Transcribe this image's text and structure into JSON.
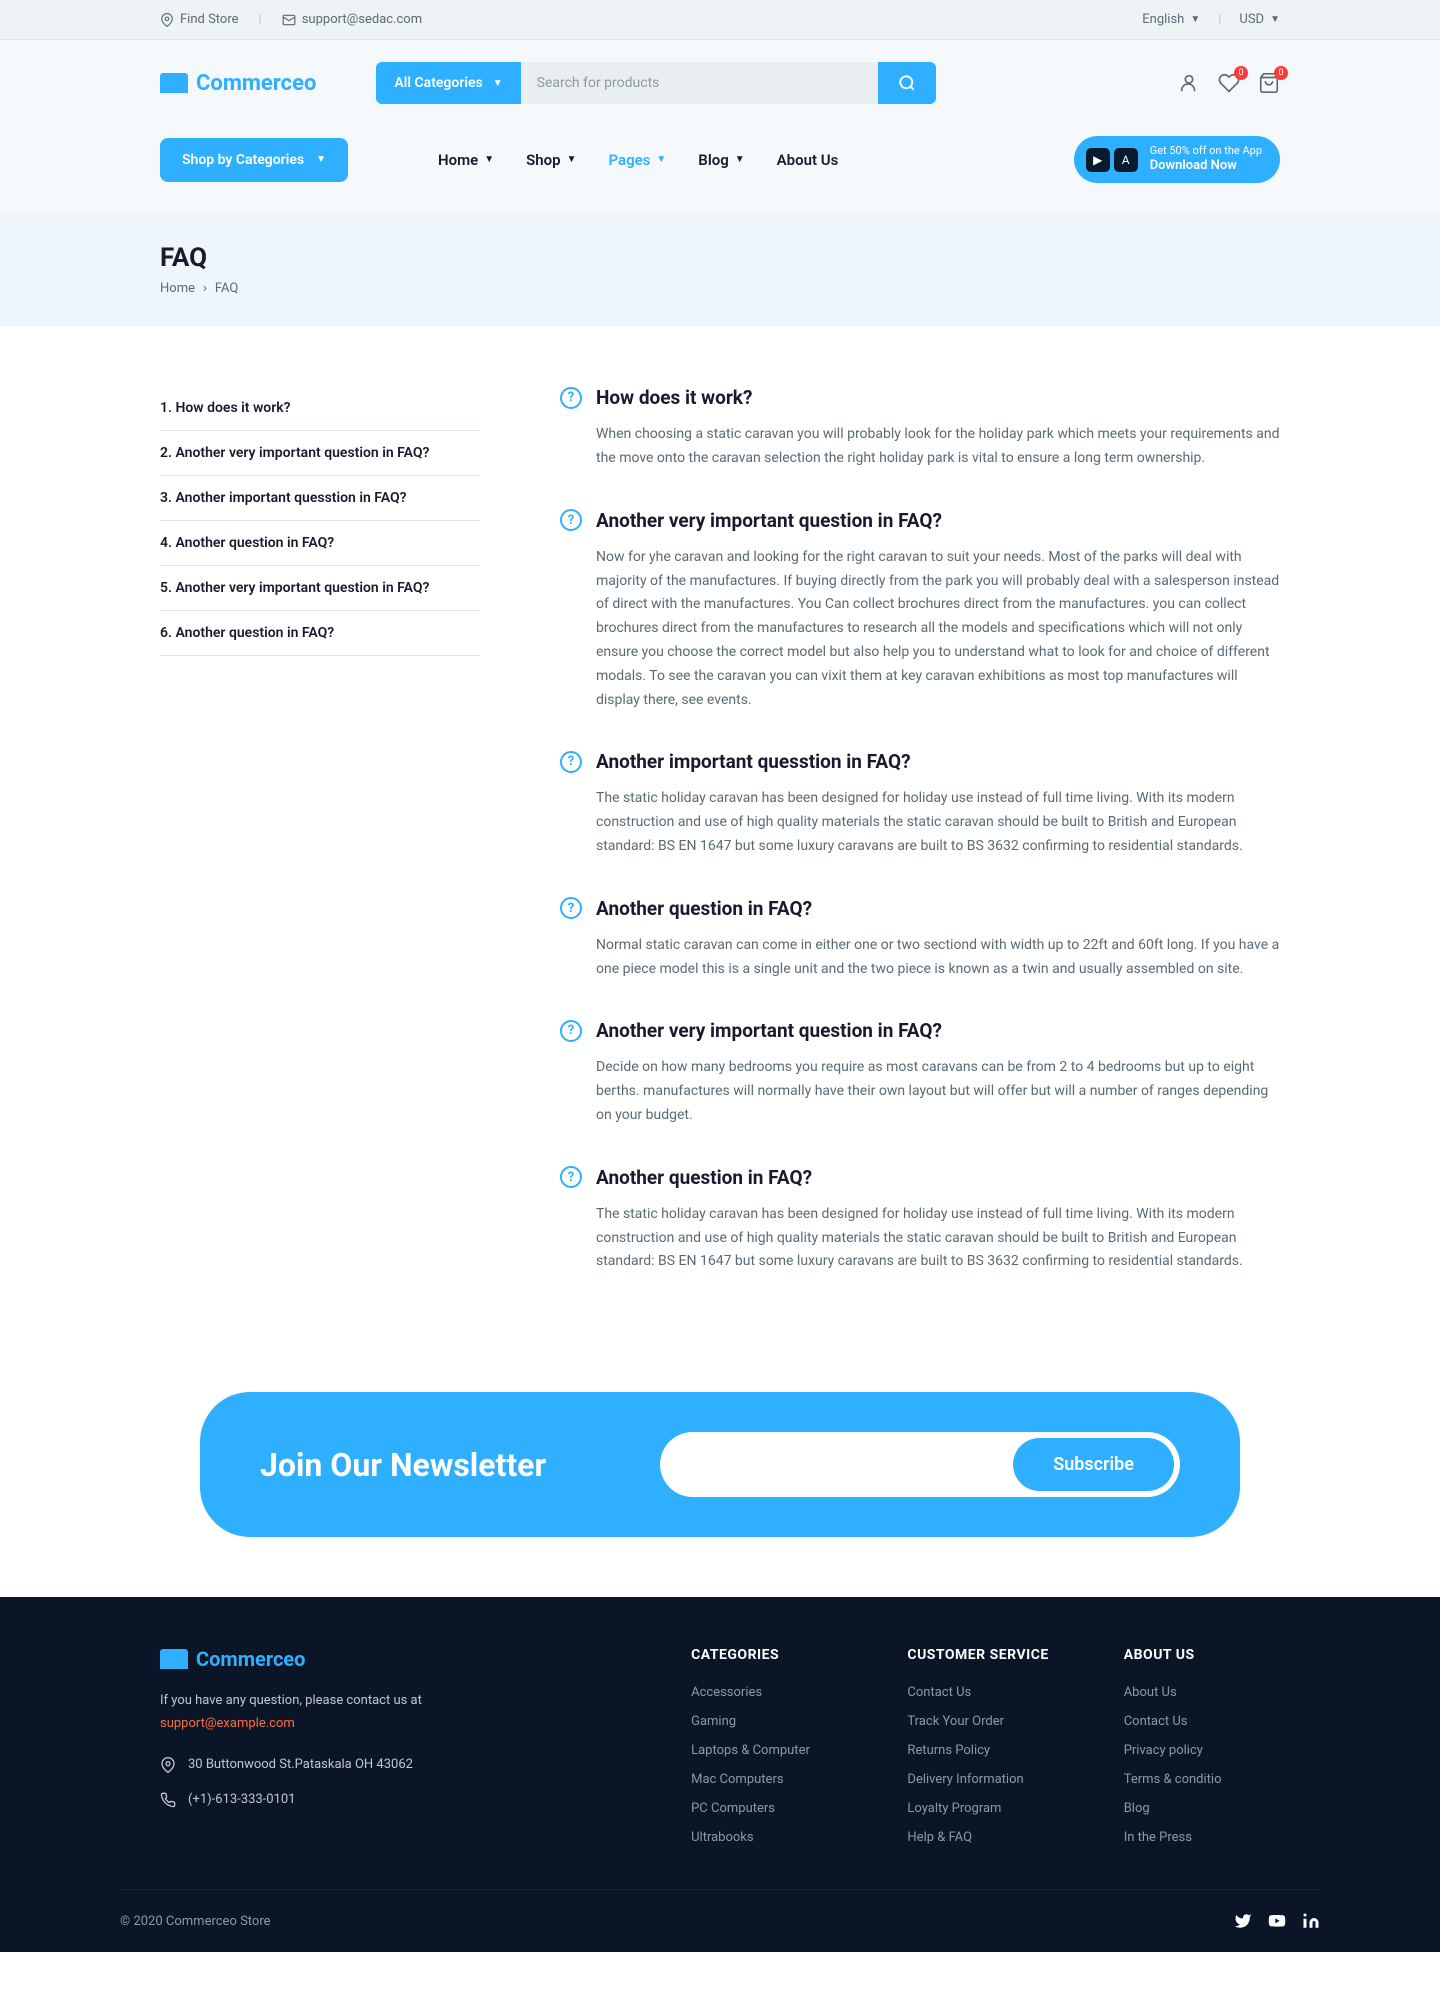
{
  "topbar": {
    "find_store": "Find Store",
    "email": "support@sedac.com",
    "language": "English",
    "currency": "USD"
  },
  "header": {
    "logo": "Commerceo",
    "categories_btn": "All Categories",
    "search_placeholder": "Search for products",
    "wishlist_count": "0",
    "cart_count": "0"
  },
  "nav": {
    "shop_by": "Shop by Categories",
    "links": [
      {
        "label": "Home",
        "dropdown": true
      },
      {
        "label": "Shop",
        "dropdown": true
      },
      {
        "label": "Pages",
        "dropdown": true,
        "active": true
      },
      {
        "label": "Blog",
        "dropdown": true
      },
      {
        "label": "About Us",
        "dropdown": false
      }
    ],
    "app_promo": "Get 50% off on the App",
    "app_cta": "Download Now"
  },
  "page": {
    "title": "FAQ",
    "breadcrumb_home": "Home",
    "breadcrumb_current": "FAQ"
  },
  "sidebar": [
    "1. How does it work?",
    "2. Another very important question in FAQ?",
    "3. Another important quesstion in FAQ?",
    "4. Another question in FAQ?",
    "5. Another very important question in FAQ?",
    "6. Another question in FAQ?"
  ],
  "faqs": [
    {
      "q": "How does it work?",
      "a": "When choosing a static caravan you will probably look for the holiday park which meets your requirements and the move onto the caravan selection the right holiday park is vital to ensure a long term ownership."
    },
    {
      "q": "Another very important question in FAQ?",
      "a": "Now for yhe caravan and looking for the right caravan to suit your needs. Most of the parks will deal with majority of the manufactures. If buying directly from the park you will probably deal with a salesperson instead of direct with the manufactures. You Can collect brochures direct from the manufactures. you can collect brochures direct from the manufactures to research all the models and specifications which will not only ensure you choose the correct model but also help you to understand what to look for and choice of different modals. To see the caravan you can vixit them at key caravan exhibitions as most top manufactures will display there, see events."
    },
    {
      "q": "Another important quesstion in FAQ?",
      "a": "The static holiday caravan has been designed for holiday use instead of full time living. With its modern construction and use of high quality materials the static caravan should be built to British and European standard: BS EN 1647 but some luxury caravans are built to BS 3632 confirming to residential standards."
    },
    {
      "q": "Another question in FAQ?",
      "a": "Normal static caravan can come in either one or two sectiond with width up to 22ft and 60ft long. If you have a one piece model this is a single unit and the two piece is known as a twin and usually assembled on site."
    },
    {
      "q": "Another very important question in FAQ?",
      "a": "Decide on how many bedrooms you require as most caravans can be from 2 to 4 bedrooms but up to eight berths. manufactures will normally have their own layout but will offer but will a number of ranges depending on your budget."
    },
    {
      "q": "Another question in FAQ?",
      "a": "The static holiday caravan has been designed for holiday use instead of full time living. With its modern construction and use of high quality materials the static caravan should be built to British and European standard: BS EN 1647 but some luxury caravans are built to BS 3632 confirming to residential standards."
    }
  ],
  "newsletter": {
    "title": "Join Our Newsletter",
    "btn": "Subscribe"
  },
  "footer": {
    "logo": "Commerceo",
    "desc": "If you have any question, please contact us at",
    "email": "support@example.com",
    "address": "30 Buttonwood St.Pataskala OH 43062",
    "phone": "(+1)-613-333-0101",
    "cols": [
      {
        "heading": "CATEGORIES",
        "links": [
          "Accessories",
          "Gaming",
          "Laptops & Computer",
          "Mac Computers",
          "PC Computers",
          "Ultrabooks"
        ]
      },
      {
        "heading": "CUSTOMER SERVICE",
        "links": [
          "Contact Us",
          "Track Your Order",
          "Returns Policy",
          "Delivery Information",
          "Loyalty Program",
          "Help & FAQ"
        ]
      },
      {
        "heading": "ABOUT US",
        "links": [
          "About Us",
          "Contact Us",
          "Privacy policy",
          "Terms & conditio",
          "Blog",
          "In the Press"
        ]
      }
    ],
    "copyright": "© 2020 Commerceo Store"
  }
}
